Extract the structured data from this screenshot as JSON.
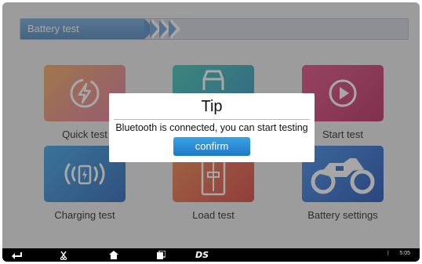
{
  "header": {
    "title": "Battery test"
  },
  "tiles": [
    {
      "label": "Quick test",
      "icon": "lightning-refresh-icon",
      "color": "#d98a6a"
    },
    {
      "label": "",
      "icon": "car-icon",
      "color": "#39b6a9"
    },
    {
      "label": "Start test",
      "icon": "play-icon",
      "color": "#c9356c"
    },
    {
      "label": "Charging test",
      "icon": "wireless-charging-icon",
      "color": "#2d7cc7"
    },
    {
      "label": "Load test",
      "icon": "load-gauge-icon",
      "color": "#e2603f"
    },
    {
      "label": "Battery settings",
      "icon": "motorcycle-icon",
      "color": "#2c6fd0"
    }
  ],
  "dialog": {
    "title": "Tip",
    "message": "Bluetooth is connected, you can start testing",
    "confirm_label": "confirm"
  },
  "navbar": {
    "brand": "DS",
    "time": "5:05",
    "bluetooth": "ᛒ"
  }
}
